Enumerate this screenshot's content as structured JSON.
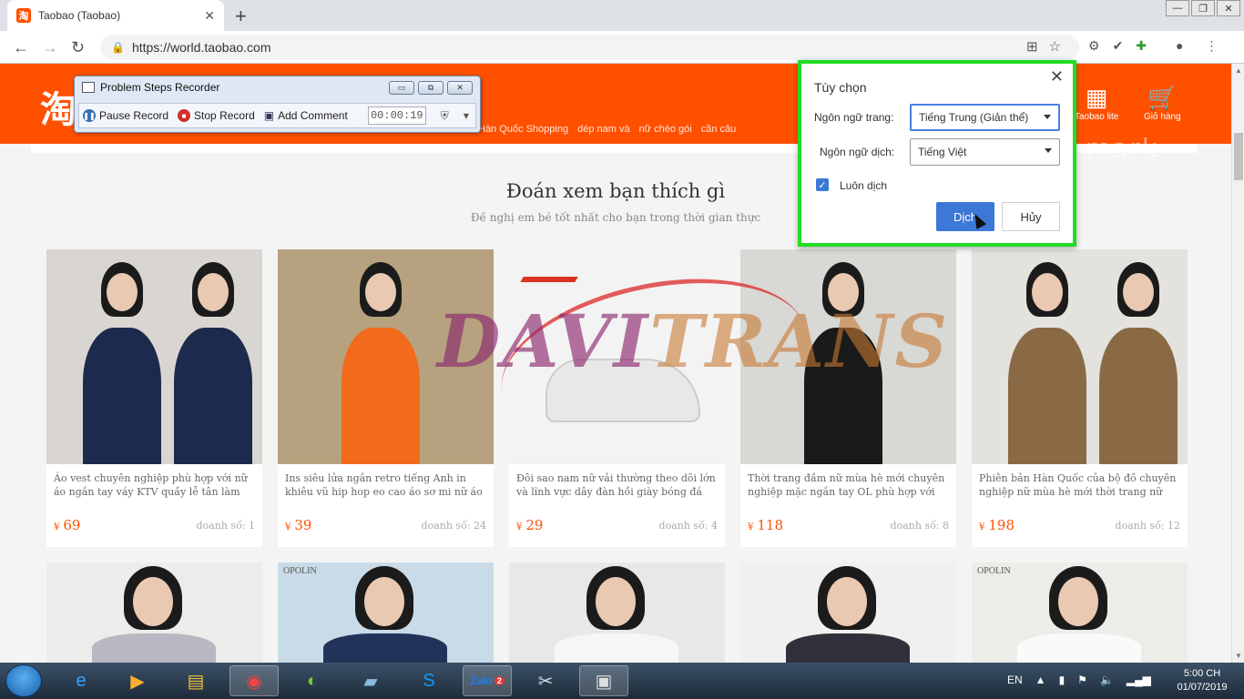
{
  "browser": {
    "tab_title": "Taobao (Taobao)",
    "favicon_char": "淘",
    "tab_close": "✕",
    "new_tab": "+",
    "url": "https://world.taobao.com",
    "win_minimize": "—",
    "win_restore": "❐",
    "win_close": "✕"
  },
  "header": {
    "logo_char": "淘",
    "nav_links": [
      "Hàn Quốc Shopping",
      "dép nam và",
      "nữ chéo gói",
      "cần câu"
    ],
    "taobao_lite": "Taobao lite",
    "cart": "Giỏ hàng",
    "mark_text": "mark"
  },
  "section": {
    "title": "Đoán xem bạn thích gì",
    "subtitle": "Đề nghị em bé tốt nhất cho bạn trong thời gian thực"
  },
  "products": [
    {
      "desc": "Áo vest chuyên nghiệp phù hợp với nữ áo ngắn tay váy KTV quầy lễ tân làm đẹp quả…",
      "currency": "¥",
      "price": "69",
      "sales": "doanh số: 1",
      "bg": "#d9d6d2",
      "cloth": "#1e2a4d"
    },
    {
      "desc": "Ins siêu lửa ngắn retro tiếng Anh in khiêu vũ hip hop eo cao áo sơ mi nữ áo thun thủy tri…",
      "currency": "¥",
      "price": "39",
      "sales": "doanh số: 24",
      "bg": "#b6a27e",
      "cloth": "#f26a1b"
    },
    {
      "desc": "Đôi sao nam nữ vải thường theo dõi lớn và lĩnh vực dây đàn hồi giày bóng đá dưới đáy…",
      "currency": "¥",
      "price": "29",
      "sales": "doanh số: 4",
      "bg": "#f3f3f3",
      "cloth": "#e8e8e8"
    },
    {
      "desc": "Thời trang đầm nữ mùa hè mới chuyên nghiệp mặc ngắn tay OL phù hợp với váy…",
      "currency": "¥",
      "price": "118",
      "sales": "doanh số: 8",
      "bg": "#d8d8d4",
      "cloth": "#1a1a1a"
    },
    {
      "desc": "Phiên bản Hàn Quốc của bộ đồ chuyên nghiệp nữ mùa hè mới thời trang nữ nhỏ…",
      "currency": "¥",
      "price": "198",
      "sales": "doanh số: 12",
      "bg": "#e4e2dd",
      "cloth": "#8a6a45"
    }
  ],
  "products_row2": [
    {
      "bg": "#ececea",
      "cloth": "#b8b8c2"
    },
    {
      "bg": "#c9dbe8",
      "cloth": "#22335a",
      "label": "OPOLIN"
    },
    {
      "bg": "#e8e8e8",
      "cloth": "#f6f6f6"
    },
    {
      "bg": "#f0f0f0",
      "cloth": "#30303a"
    },
    {
      "bg": "#ecece8",
      "cloth": "#fafafa",
      "label": "OPOLIN"
    }
  ],
  "watermark": {
    "part1": "DAVI",
    "part2": "TRANS"
  },
  "psr": {
    "title": "Problem Steps Recorder",
    "pause": "Pause Record",
    "stop": "Stop Record",
    "add_comment": "Add Comment",
    "timer": "00:00:19"
  },
  "translate": {
    "title": "Tùy chọn",
    "page_lang_label": "Ngôn ngữ trang:",
    "page_lang_value": "Tiếng Trung (Giản thể)",
    "target_lang_label": "Ngôn ngữ dịch:",
    "target_lang_value": "Tiếng Việt",
    "always_translate": "Luôn dịch",
    "translate_btn": "Dịch",
    "cancel_btn": "Hủy"
  },
  "taskbar": {
    "lang": "EN",
    "time": "5:00 CH",
    "date": "01/07/2019",
    "zalo_badge": "2"
  },
  "colors": {
    "taobao_orange": "#ff5000",
    "highlight_green": "#22dd22",
    "button_blue": "#3c78d8"
  }
}
